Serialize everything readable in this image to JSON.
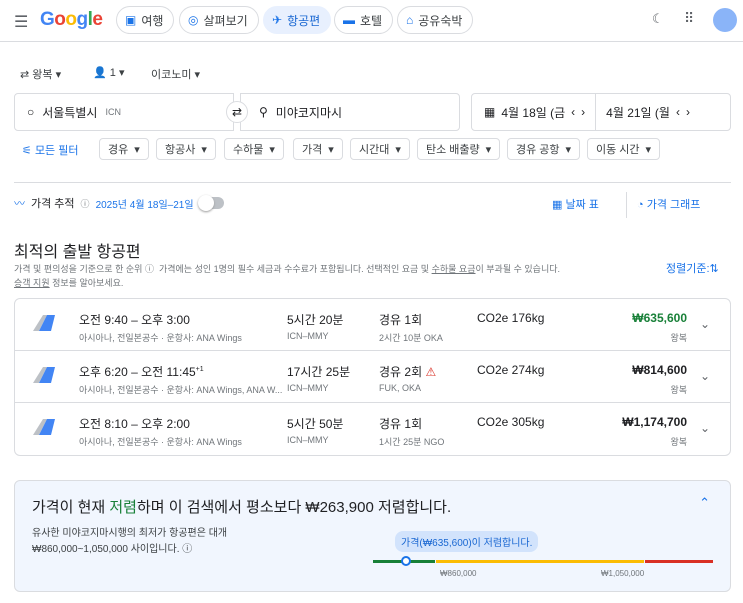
{
  "header": {
    "logo": "Google",
    "tabs": [
      {
        "label": "여행",
        "icon": "luggage-icon"
      },
      {
        "label": "살펴보기",
        "icon": "explore-icon"
      },
      {
        "label": "항공편",
        "icon": "flight-icon"
      },
      {
        "label": "호텔",
        "icon": "hotel-icon"
      },
      {
        "label": "공유숙박",
        "icon": "home-icon"
      }
    ]
  },
  "search": {
    "trip_type": "왕복",
    "passengers": "1",
    "cabin": "이코노미",
    "origin": "서울특별시",
    "origin_code": "ICN",
    "destination": "미야코지마시",
    "depart": "4월 18일 (금",
    "return": "4월 21일 (월"
  },
  "filters": {
    "all": "모든 필터",
    "chips": [
      "경유",
      "항공사",
      "수하물",
      "가격",
      "시간대",
      "탄소 배출량",
      "경유 공항",
      "이동 시간"
    ]
  },
  "tracking": {
    "label": "가격 추적",
    "dates": "2025년 4월 18일–21일",
    "toggle_on": false,
    "date_grid": "날짜 표",
    "price_graph": "가격 그래프"
  },
  "results": {
    "title": "최적의 출발 항공편",
    "note1": "가격 및 편의성을 기준으로 한 순위",
    "note2": "가격에는 성인 1명의 필수 세금과 수수료가 포함됩니다. 선택적인 요금 및 ",
    "note_link": "수하물 요금",
    "note3": "이 부과될 수 있습니다.",
    "note_link2": "승객 지원",
    "note4": " 정보를 알아보세요.",
    "sort": "정렬기준:",
    "flights": [
      {
        "time": "오전 9:40 – 오후 3:00",
        "plus": "",
        "airline": "아시아나, 전일본공수 · 운항사: ANA Wings",
        "duration": "5시간 20분",
        "route": "ICN–MMY",
        "stops": "경유 1회",
        "stop_detail": "2시간 10분 OKA",
        "co2": "CO2e 176kg",
        "price": "₩635,600",
        "price_type": "왕복",
        "warn": false,
        "cheap": true
      },
      {
        "time": "오후 6:20 – 오전 11:45",
        "plus": "+1",
        "airline": "아시아나, 전일본공수 · 운항사: ANA Wings, ANA W...",
        "duration": "17시간 25분",
        "route": "ICN–MMY",
        "stops": "경유 2회",
        "stop_detail": "FUK, OKA",
        "co2": "CO2e 274kg",
        "price": "₩814,600",
        "price_type": "왕복",
        "warn": true,
        "cheap": false
      },
      {
        "time": "오전 8:10 – 오후 2:00",
        "plus": "",
        "airline": "아시아나, 전일본공수 · 운항사: ANA Wings",
        "duration": "5시간 50분",
        "route": "ICN–MMY",
        "stops": "경유 1회",
        "stop_detail": "1시간 25분 NGO",
        "co2": "CO2e 305kg",
        "price": "₩1,174,700",
        "price_type": "왕복",
        "warn": false,
        "cheap": false
      }
    ]
  },
  "insight": {
    "pre": "가격이 현재 ",
    "low": "저렴",
    "post": "하며 이 검색에서 평소보다 ₩263,900 저렴합니다.",
    "desc1": "유사한 미야코지마시행의 최저가 항공편은 대개",
    "desc2": "₩860,000~1,050,000 사이입니다.",
    "tooltip": "가격(₩635,600)이 저렴합니다.",
    "low_tick": "₩860,000",
    "high_tick": "₩1,050,000"
  },
  "colors": {
    "accent": "#1a73e8",
    "green": "#188038",
    "red": "#d93025",
    "yellow": "#fbbc04"
  }
}
